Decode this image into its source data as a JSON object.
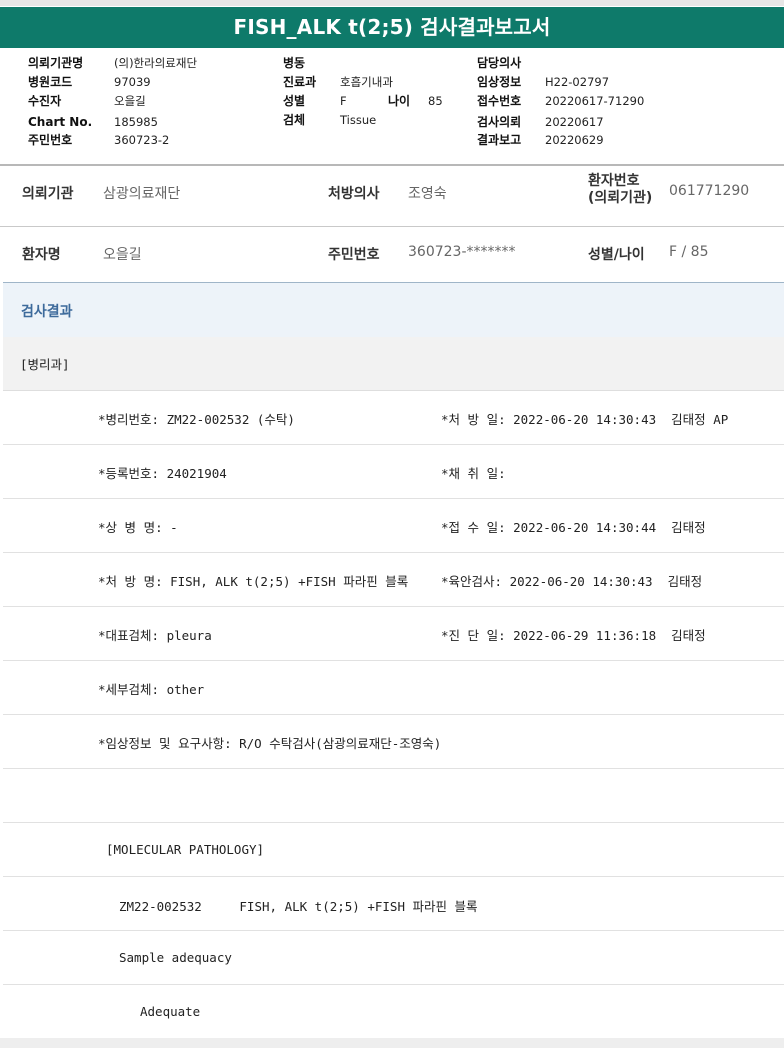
{
  "title": "FISH_ALK t(2;5) 검사결과보고서",
  "report_header": {
    "col1": [
      {
        "label": "의뢰기관명",
        "value": "(의)한라의료재단"
      },
      {
        "label": "병원코드",
        "value": "97039"
      },
      {
        "label": "수진자",
        "value": "오을길"
      },
      {
        "label": "Chart No.",
        "value": "185985"
      },
      {
        "label": "주민번호",
        "value": "360723-2"
      }
    ],
    "col2": [
      {
        "label": "병동",
        "value": ""
      },
      {
        "label": "진료과",
        "value": "호흡기내과"
      },
      {
        "label": "성별",
        "value": "F"
      },
      {
        "label": "검체",
        "value": "Tissue"
      }
    ],
    "age_label": "나이",
    "age_value": "85",
    "col3": [
      {
        "label": "담당의사",
        "value": ""
      },
      {
        "label": "임상정보",
        "value": "H22-02797"
      },
      {
        "label": "접수번호",
        "value": "20220617-71290"
      },
      {
        "label": "검사의뢰",
        "value": "20220617"
      },
      {
        "label": "결과보고",
        "value": "20220629"
      }
    ]
  },
  "patient_info": {
    "institution_label": "의뢰기관",
    "institution_value": "삼광의료재단",
    "doctor_label": "처방의사",
    "doctor_value": "조영숙",
    "patient_no_label_1": "환자번호",
    "patient_no_label_2": "(의뢰기관)",
    "patient_no_value": "061771290",
    "name_label": "환자명",
    "name_value": "오을길",
    "rrn_label": "주민번호",
    "rrn_value": "360723-*******",
    "sexage_label": "성별/나이",
    "sexage_value": "F / 85"
  },
  "results": {
    "section_title": "검사결과",
    "department": "[병리과]",
    "rows": [
      {
        "left": "*병리번호: ZM22-002532 (수탁)",
        "right": "*처 방 일: 2022-06-20 14:30:43  김태정 AP"
      },
      {
        "left": "*등록번호: 24021904",
        "right": "*채 취 일:"
      },
      {
        "left": "*상 병 명: -",
        "right": "*접 수 일: 2022-06-20 14:30:44  김태정"
      },
      {
        "left": "*처 방 명: FISH, ALK t(2;5) +FISH 파라핀 블록",
        "right": "*육안검사: 2022-06-20 14:30:43  김태정"
      },
      {
        "left": "*대표검체: pleura",
        "right": "*진 단 일: 2022-06-29 11:36:18  김태정"
      },
      {
        "left": "*세부검체: other",
        "right": ""
      },
      {
        "left": "*임상정보 및 요구사항: R/O 수탁검사(삼광의료재단-조영숙)",
        "right": ""
      }
    ],
    "molecular_title": "[MOLECULAR PATHOLOGY]",
    "molecular_line": "ZM22-002532     FISH, ALK t(2;5) +FISH 파라핀 블록",
    "sample_adequacy_label": "Sample adequacy",
    "sample_adequacy_value": "Adequate"
  }
}
